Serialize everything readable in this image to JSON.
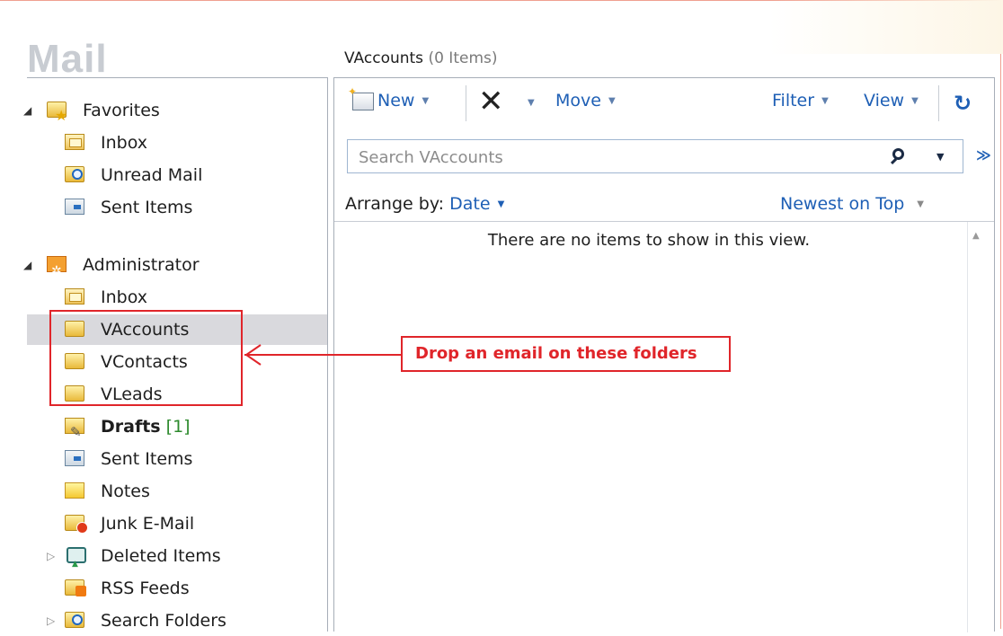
{
  "app": {
    "title": "Mail"
  },
  "nav": {
    "favorites": {
      "label": "Favorites",
      "items": [
        {
          "label": "Inbox",
          "icon": "inbox-folder-icon"
        },
        {
          "label": "Unread Mail",
          "icon": "search-folder-icon"
        },
        {
          "label": "Sent Items",
          "icon": "sent-items-icon"
        }
      ]
    },
    "mailbox": {
      "label": "Administrator",
      "items": [
        {
          "label": "Inbox"
        },
        {
          "label": "VAccounts"
        },
        {
          "label": "VContacts"
        },
        {
          "label": "VLeads"
        },
        {
          "label": "Drafts",
          "count": "[1]"
        },
        {
          "label": "Sent Items"
        },
        {
          "label": "Notes"
        },
        {
          "label": "Junk E-Mail"
        },
        {
          "label": "Deleted Items"
        },
        {
          "label": "RSS Feeds"
        },
        {
          "label": "Search Folders"
        }
      ]
    }
  },
  "folder": {
    "name": "VAccounts",
    "count": "(0 Items)"
  },
  "toolbar": {
    "new_label": "New",
    "move_label": "Move",
    "filter_label": "Filter",
    "view_label": "View"
  },
  "search": {
    "placeholder": "Search VAccounts"
  },
  "arrange": {
    "label": "Arrange by:",
    "value": "Date",
    "sort": "Newest on Top"
  },
  "list": {
    "empty_message": "There are no items to show in this view."
  },
  "annotation": {
    "callout": "Drop an email on these folders"
  },
  "colors": {
    "accent": "#1e5fb5",
    "annotation": "#e0252a",
    "selection": "#d9d9dd"
  }
}
